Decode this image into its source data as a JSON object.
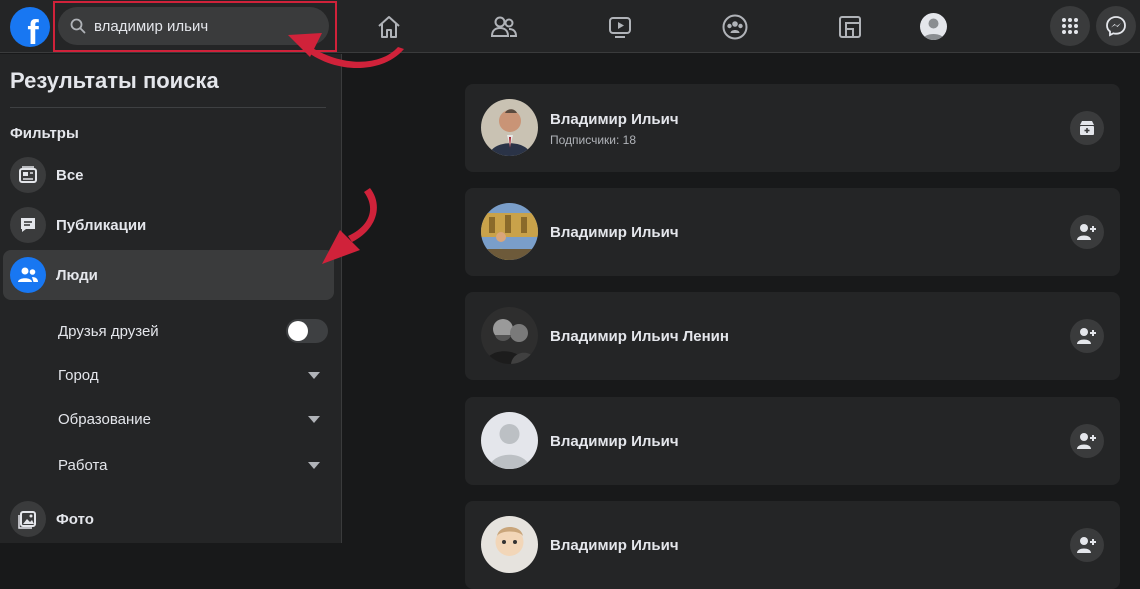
{
  "header": {
    "logo_letter": "f",
    "search_value": "владимир ильич"
  },
  "icons": {
    "home": "home-icon",
    "friends": "friends-icon",
    "watch": "watch-icon",
    "groups": "groups-icon",
    "gaming": "gaming-icon",
    "menu": "grid-menu-icon",
    "messenger": "messenger-icon"
  },
  "colors": {
    "accent": "#1877f2",
    "annotation": "#d0223a"
  },
  "sidebar": {
    "title": "Результаты поиска",
    "filters_label": "Фильтры",
    "items": [
      {
        "label": "Все"
      },
      {
        "label": "Публикации"
      },
      {
        "label": "Люди"
      },
      {
        "label": "Фото"
      }
    ],
    "sub_filters": [
      {
        "label": "Друзья друзей"
      },
      {
        "label": "Город"
      },
      {
        "label": "Образование"
      },
      {
        "label": "Работа"
      }
    ]
  },
  "results": [
    {
      "name": "Владимир Ильич",
      "meta": "Подписчики: 18",
      "action_icon": "add-page-icon"
    },
    {
      "name": "Владимир Ильич",
      "meta": "",
      "action_icon": "add-friend-icon"
    },
    {
      "name": "Владимир Ильич Ленин",
      "meta": "",
      "action_icon": "add-friend-icon"
    },
    {
      "name": "Владимир Ильич",
      "meta": "",
      "action_icon": "add-friend-icon"
    },
    {
      "name": "Владимир Ильич",
      "meta": "",
      "action_icon": "add-friend-icon"
    }
  ]
}
